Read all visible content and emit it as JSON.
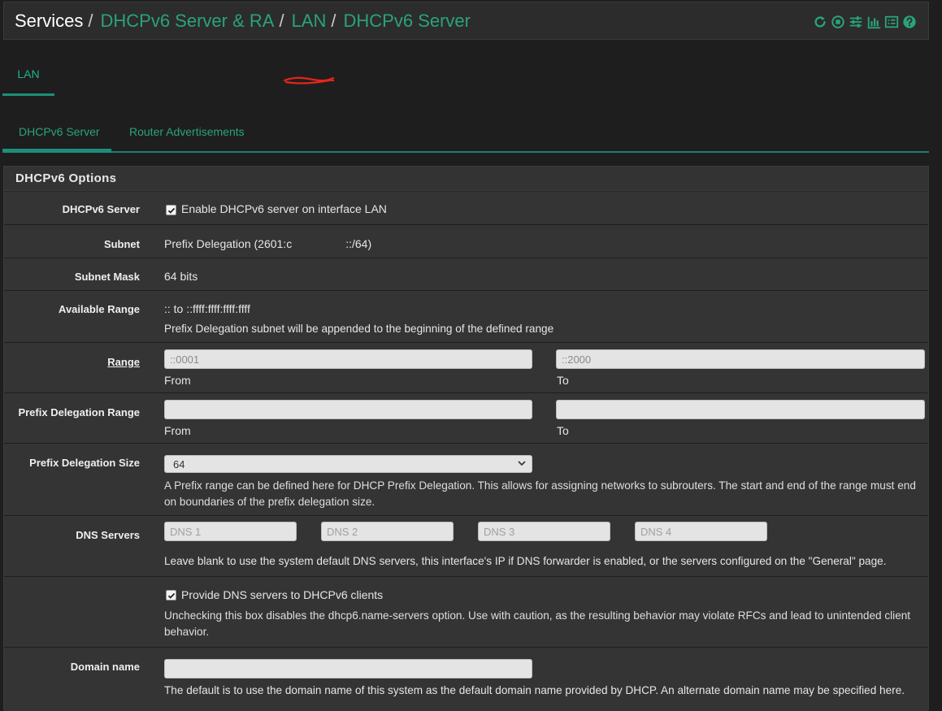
{
  "breadcrumb": {
    "root": "Services",
    "items": [
      "DHCPv6 Server & RA",
      "LAN",
      "DHCPv6 Server"
    ]
  },
  "toolbar_icons": [
    "reload-icon",
    "stop-icon",
    "sliders-icon",
    "chart-icon",
    "list-icon",
    "help-icon"
  ],
  "colors": {
    "accent": "#2aa37a",
    "background": "#1e1e1e",
    "panel": "#343434"
  },
  "interface_tab": "LAN",
  "subtabs": [
    "DHCPv6 Server",
    "Router Advertisements"
  ],
  "panel_title": "DHCPv6 Options",
  "fields": {
    "dhcpv6_server": {
      "label": "DHCPv6 Server",
      "checkbox_label": "Enable DHCPv6 server on interface LAN",
      "checked": true
    },
    "subnet": {
      "label": "Subnet",
      "prefix": "Prefix Delegation (2601:c",
      "suffix": "::/64)"
    },
    "subnet_mask": {
      "label": "Subnet Mask",
      "value": "64 bits"
    },
    "available_range": {
      "label": "Available Range",
      "value": ":: to ::ffff:ffff:ffff:ffff",
      "help": "Prefix Delegation subnet will be appended to the beginning of the defined range"
    },
    "range": {
      "label": "Range",
      "from_placeholder": "::0001",
      "to_placeholder": "::2000",
      "from_label": "From",
      "to_label": "To"
    },
    "pd_range": {
      "label": "Prefix Delegation Range",
      "from_label": "From",
      "to_label": "To"
    },
    "pd_size": {
      "label": "Prefix Delegation Size",
      "selected": "64",
      "help": "A Prefix range can be defined here for DHCP Prefix Delegation. This allows for assigning networks to subrouters. The start and end of the range must end on boundaries of the prefix delegation size."
    },
    "dns_servers": {
      "label": "DNS Servers",
      "placeholders": [
        "DNS 1",
        "DNS 2",
        "DNS 3",
        "DNS 4"
      ],
      "help": "Leave blank to use the system default DNS servers, this interface's IP if DNS forwarder is enabled, or the servers configured on the \"General\" page."
    },
    "provide_dns": {
      "checkbox_label": "Provide DNS servers to DHCPv6 clients",
      "checked": true,
      "help": "Unchecking this box disables the dhcp6.name-servers option. Use with caution, as the resulting behavior may violate RFCs and lead to unintended client behavior."
    },
    "domain_name": {
      "label": "Domain name",
      "help": "The default is to use the domain name of this system as the default domain name provided by DHCP. An alternate domain name may be specified here."
    }
  }
}
